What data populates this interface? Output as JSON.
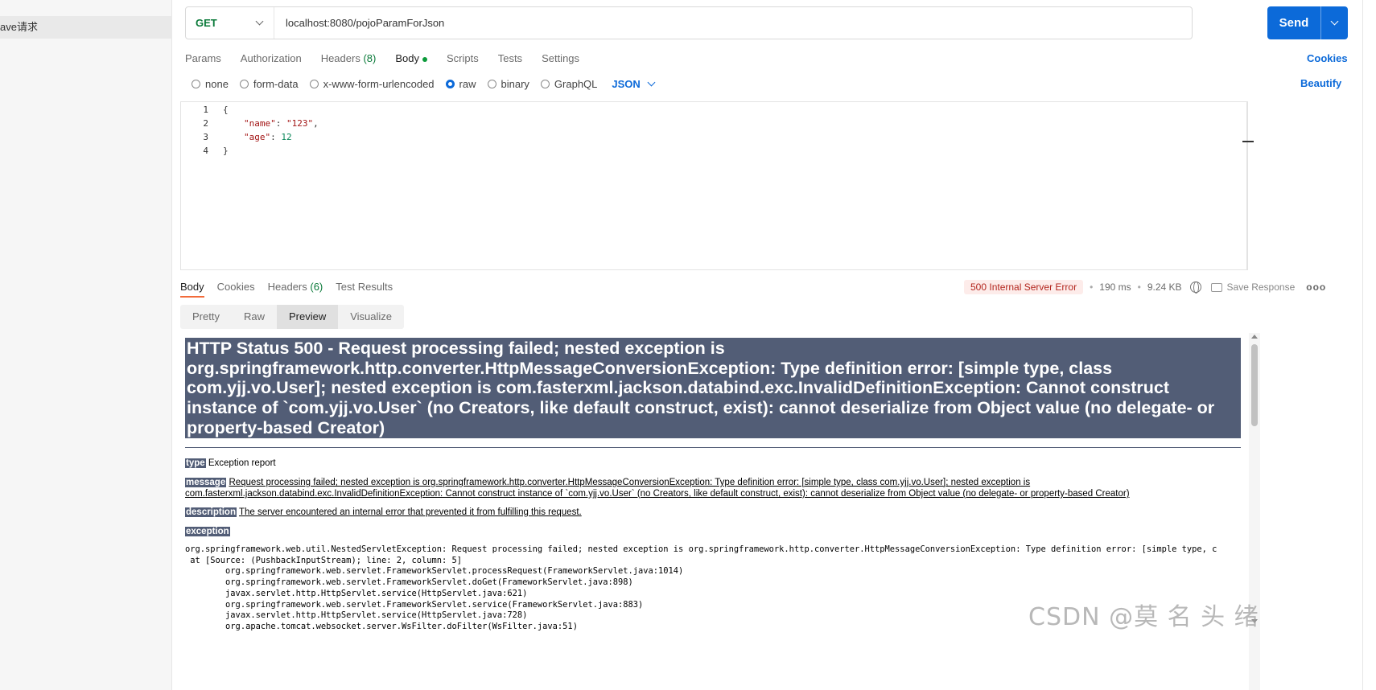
{
  "sidebar": {
    "selected_item": "ave请求"
  },
  "request": {
    "method": "GET",
    "url": "localhost:8080/pojoParamForJson",
    "send_label": "Send"
  },
  "req_tabs": {
    "params": "Params",
    "authorization": "Authorization",
    "headers": "Headers",
    "headers_count": "(8)",
    "body": "Body",
    "scripts": "Scripts",
    "tests": "Tests",
    "settings": "Settings",
    "cookies": "Cookies"
  },
  "body_options": {
    "none": "none",
    "form_data": "form-data",
    "urlencoded": "x-www-form-urlencoded",
    "raw": "raw",
    "binary": "binary",
    "graphql": "GraphQL",
    "selected": "raw",
    "format": "JSON",
    "beautify": "Beautify"
  },
  "editor": {
    "lines": [
      {
        "num": "1",
        "text": "{"
      },
      {
        "num": "2",
        "key": "\"name\"",
        "value": "\"123\""
      },
      {
        "num": "3",
        "key": "\"age\"",
        "value": "12"
      },
      {
        "num": "4",
        "text": "}"
      }
    ]
  },
  "response": {
    "tabs": {
      "body": "Body",
      "cookies": "Cookies",
      "headers": "Headers",
      "headers_count": "(6)",
      "test_results": "Test Results"
    },
    "status": "500 Internal Server Error",
    "time": "190 ms",
    "size": "9.24 KB",
    "save_response": "Save Response",
    "more": "ooo",
    "views": {
      "pretty": "Pretty",
      "raw": "Raw",
      "preview": "Preview",
      "visualize": "Visualize"
    }
  },
  "preview": {
    "title": "HTTP Status 500 - Request processing failed; nested exception is org.springframework.http.converter.HttpMessageConversionException: Type definition error: [simple type, class com.yjj.vo.User]; nested exception is com.fasterxml.jackson.databind.exc.InvalidDefinitionException: Cannot construct instance of `com.yjj.vo.User` (no Creators, like default construct, exist): cannot deserialize from Object value (no delegate- or property-based Creator)",
    "type_label": "type",
    "type_value": "Exception report",
    "message_label": "message",
    "message_value": "Request processing failed; nested exception is org.springframework.http.converter.HttpMessageConversionException: Type definition error: [simple type, class com.yjj.vo.User]; nested exception is com.fasterxml.jackson.databind.exc.InvalidDefinitionException: Cannot construct instance of `com.yjj.vo.User` (no Creators, like default construct, exist): cannot deserialize from Object value (no delegate- or property-based Creator)",
    "description_label": "description",
    "description_value": "The server encountered an internal error that prevented it from fulfilling this request.",
    "exception_label": "exception",
    "trace": "org.springframework.web.util.NestedServletException: Request processing failed; nested exception is org.springframework.http.converter.HttpMessageConversionException: Type definition error: [simple type, c\n at [Source: (PushbackInputStream); line: 2, column: 5]\n\torg.springframework.web.servlet.FrameworkServlet.processRequest(FrameworkServlet.java:1014)\n\torg.springframework.web.servlet.FrameworkServlet.doGet(FrameworkServlet.java:898)\n\tjavax.servlet.http.HttpServlet.service(HttpServlet.java:621)\n\torg.springframework.web.servlet.FrameworkServlet.service(FrameworkServlet.java:883)\n\tjavax.servlet.http.HttpServlet.service(HttpServlet.java:728)\n\torg.apache.tomcat.websocket.server.WsFilter.doFilter(WsFilter.java:51)"
  },
  "watermark": "CSDN @莫 名 头 绪"
}
